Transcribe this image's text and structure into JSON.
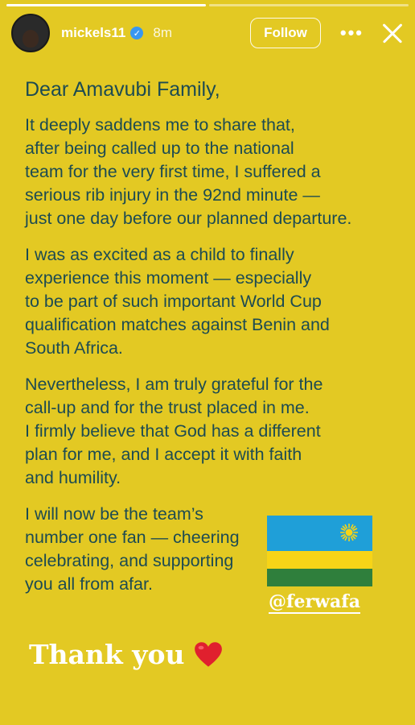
{
  "story": {
    "progress": {
      "segments": 2,
      "current": 1,
      "fill": 0.5
    },
    "username": "mickels11",
    "verified": true,
    "time": "8m",
    "follow_label": "Follow",
    "more_label": "•••"
  },
  "letter": {
    "greeting": "Dear Amavubi Family,",
    "paragraphs": [
      [
        "It deeply saddens me to share that,",
        "after being called up to the national",
        "team for the very first time, I suffered a",
        "serious rib injury in the 92nd minute —",
        "just one day before our planned departure."
      ],
      [
        "I was as excited as a child to finally",
        "experience this moment — especially",
        "to be part of such important World Cup",
        "qualification matches against Benin and",
        "South Africa."
      ],
      [
        "Nevertheless, I am truly grateful for the",
        "call-up and for the trust placed in me.",
        "I firmly believe that God has a different",
        "plan for me, and I accept it with faith",
        "and humility."
      ],
      [
        "I will now be the team’s",
        "number one fan — cheering",
        "celebrating, and supporting",
        "you all from afar."
      ]
    ]
  },
  "mention": "@ferwafa",
  "thanks": "Thank you",
  "colors": {
    "background": "#e3c923",
    "text": "#1d4b52",
    "flag_blue": "#1f9fd8",
    "flag_yellow": "#f7d417",
    "flag_green": "#2f7f3c"
  },
  "icons": [
    "verified-badge-icon",
    "more-icon",
    "close-icon",
    "rwanda-flag-icon",
    "heart-emoji-icon"
  ]
}
